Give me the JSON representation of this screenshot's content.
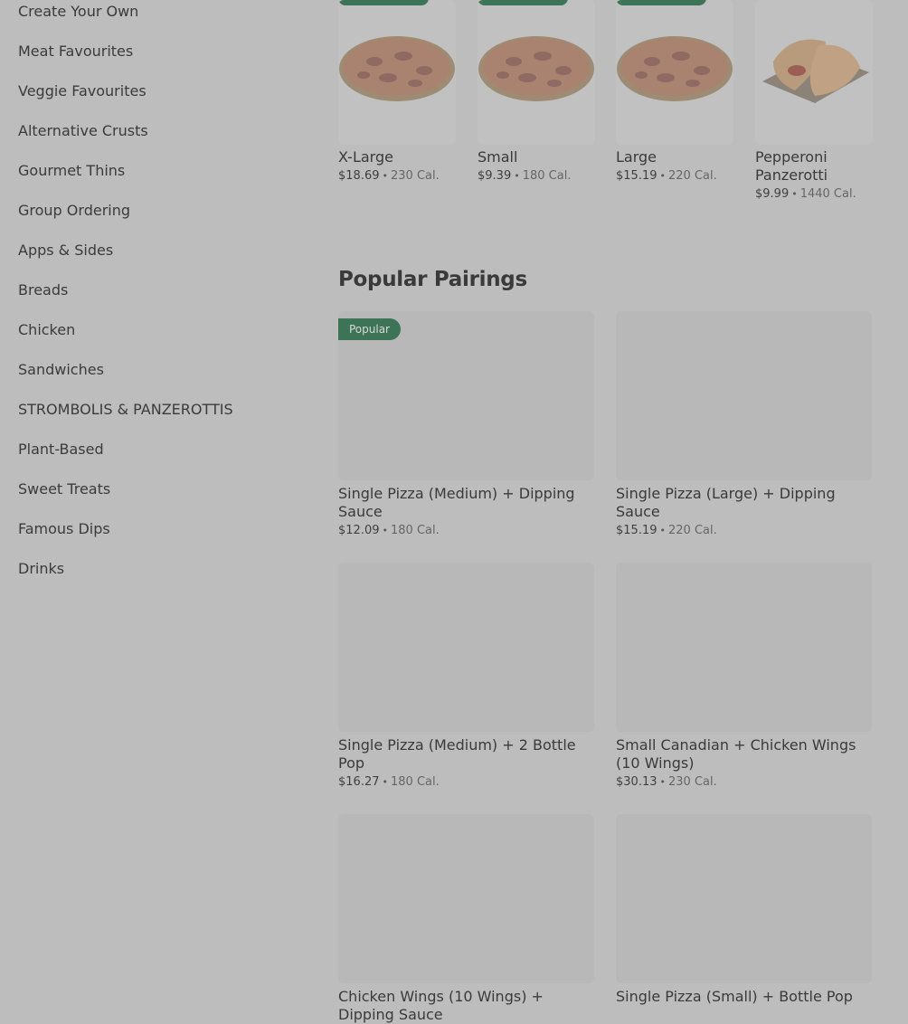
{
  "sidebar": {
    "items": [
      {
        "label": "Create Your Own"
      },
      {
        "label": "Meat Favourites"
      },
      {
        "label": "Veggie Favourites"
      },
      {
        "label": "Alternative Crusts"
      },
      {
        "label": "Gourmet Thins"
      },
      {
        "label": "Group Ordering"
      },
      {
        "label": "Apps & Sides"
      },
      {
        "label": "Breads"
      },
      {
        "label": "Chicken"
      },
      {
        "label": "Sandwiches"
      },
      {
        "label": "STROMBOLIS & PANZEROTTIS"
      },
      {
        "label": "Plant-Based"
      },
      {
        "label": "Sweet Treats"
      },
      {
        "label": "Famous Dips"
      },
      {
        "label": "Drinks"
      }
    ]
  },
  "sizes": [
    {
      "title": "X-Large",
      "price": "$18.69",
      "separator": "•",
      "calories": "230 Cal."
    },
    {
      "title": "Small",
      "price": "$9.39",
      "separator": "•",
      "calories": "180 Cal."
    },
    {
      "title": "Large",
      "price": "$15.19",
      "separator": "•",
      "calories": "220 Cal."
    },
    {
      "title": "Pepperoni Panzerotti",
      "price": "$9.99",
      "separator": "•",
      "calories": "1440 Cal."
    }
  ],
  "pairings": {
    "heading": "Popular Pairings",
    "badge": "Popular",
    "items": [
      {
        "title": "Single Pizza (Medium) + Dipping Sauce",
        "price": "$12.09",
        "separator": "•",
        "calories": "180 Cal."
      },
      {
        "title": "Single Pizza (Large) + Dipping Sauce",
        "price": "$15.19",
        "separator": "•",
        "calories": "220 Cal."
      },
      {
        "title": "Single Pizza (Medium) + 2 Bottle Pop",
        "price": "$16.27",
        "separator": "•",
        "calories": "180 Cal."
      },
      {
        "title": "Small Canadian + Chicken Wings (10 Wings)",
        "price": "$30.13",
        "separator": "•",
        "calories": "230 Cal."
      },
      {
        "title": "Chicken Wings (10 Wings) + Dipping Sauce",
        "price": "",
        "separator": "",
        "calories": ""
      },
      {
        "title": "Single Pizza (Small) + Bottle Pop",
        "price": "",
        "separator": "",
        "calories": ""
      }
    ]
  },
  "colors": {
    "overlay_background": "#bdbdbd",
    "badge_green": "#3d7356"
  }
}
